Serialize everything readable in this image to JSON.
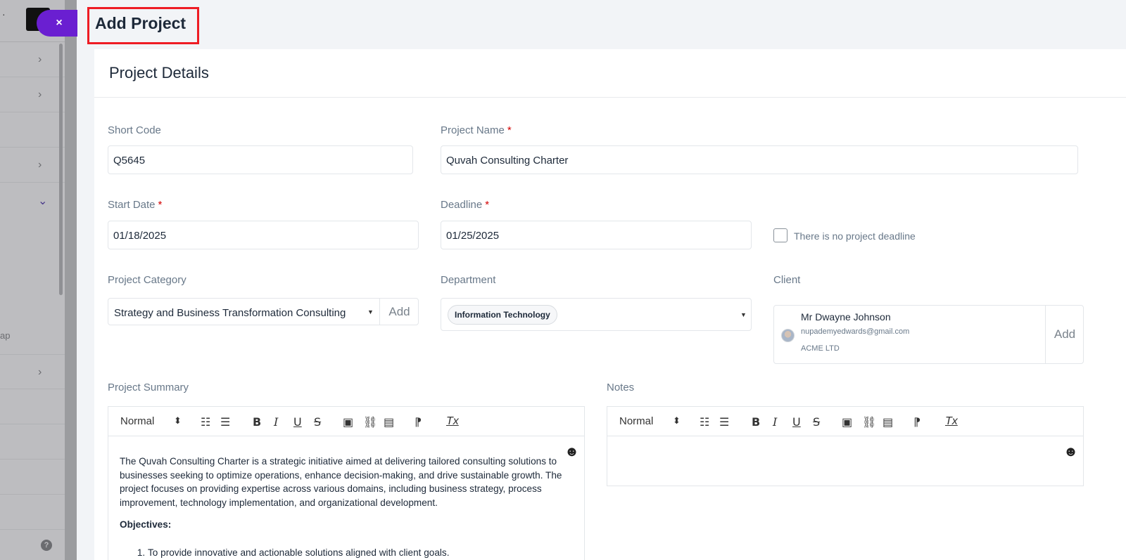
{
  "page": {
    "title": "Add Project",
    "close_label": "×"
  },
  "sidebar": {
    "partial_text": "ap",
    "help_glyph": "?"
  },
  "card": {
    "title": "Project Details"
  },
  "form": {
    "short_code": {
      "label": "Short Code",
      "value": "Q5645"
    },
    "project_name": {
      "label": "Project Name",
      "required": "*",
      "value": "Quvah Consulting Charter"
    },
    "start_date": {
      "label": "Start Date",
      "required": "*",
      "value": "01/18/2025"
    },
    "deadline": {
      "label": "Deadline",
      "required": "*",
      "value": "01/25/2025"
    },
    "no_deadline": {
      "label": "There is no project deadline",
      "checked": false
    },
    "category": {
      "label": "Project Category",
      "value": "Strategy and Business Transformation Consulting",
      "add_label": "Add"
    },
    "department": {
      "label": "Department",
      "value": "Information Technology"
    },
    "client": {
      "label": "Client",
      "name": "Mr Dwayne Johnson",
      "email": "nupademyedwards@gmail.com",
      "company": "ACME LTD",
      "add_label": "Add"
    }
  },
  "editors": {
    "toolbar": {
      "format": "Normal",
      "format_arrow": "⬍",
      "ol": "☷",
      "ul": "☰",
      "bold": "B",
      "italic": "I",
      "underline": "U",
      "strike": "S",
      "image": "▣",
      "link": "⛓",
      "video": "▤",
      "rtl": "⁋",
      "clean": "Tx",
      "emoji": "☻"
    },
    "summary": {
      "label": "Project Summary",
      "paragraph": "The Quvah Consulting Charter is a strategic initiative aimed at delivering tailored consulting solutions to businesses seeking to optimize operations, enhance decision-making, and drive sustainable growth. The project focuses on providing expertise across various domains, including business strategy, process improvement, technology implementation, and organizational development.",
      "objectives_heading": "Objectives:",
      "objectives": [
        "To provide innovative and actionable solutions aligned with client goals."
      ]
    },
    "notes": {
      "label": "Notes"
    }
  },
  "colors": {
    "accent": "#6a1fd1",
    "highlight_border": "#ee1c24",
    "required": "#d30000"
  }
}
